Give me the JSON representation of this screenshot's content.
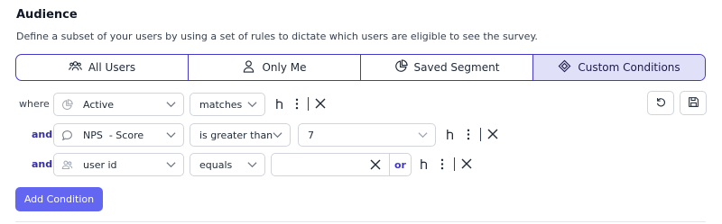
{
  "header": {
    "title": "Audience",
    "description": "Define a subset of your users by using a set of rules to dictate which users are eligible to see the survey."
  },
  "tabs": [
    {
      "label": "All Users",
      "icon": "users-icon",
      "active": false
    },
    {
      "label": "Only Me",
      "icon": "user-icon",
      "active": false
    },
    {
      "label": "Saved Segment",
      "icon": "pie-chart-icon",
      "active": false
    },
    {
      "label": "Custom Conditions",
      "icon": "diamond-icon",
      "active": true
    }
  ],
  "rules": [
    {
      "connector": "where",
      "attribute": "Active",
      "attribute_icon": "pie-chart-icon",
      "operator": "matches",
      "value": ""
    },
    {
      "connector": "and",
      "attribute": "NPS  - Score",
      "attribute_icon": "chat-bubble-icon",
      "operator": "is greater than",
      "value": "7"
    },
    {
      "connector": "and",
      "attribute": "user id",
      "attribute_icon": "users-icon",
      "operator": "equals",
      "value": "",
      "or_label": "or"
    }
  ],
  "actions": {
    "add_condition": "Add Condition",
    "reset_icon": "undo-icon",
    "save_icon": "save-icon"
  },
  "colors": {
    "accent": "#4338ca",
    "active_tab_bg": "#e0e1f8",
    "button_bg": "#6366f1",
    "connector": "#3730a3"
  }
}
